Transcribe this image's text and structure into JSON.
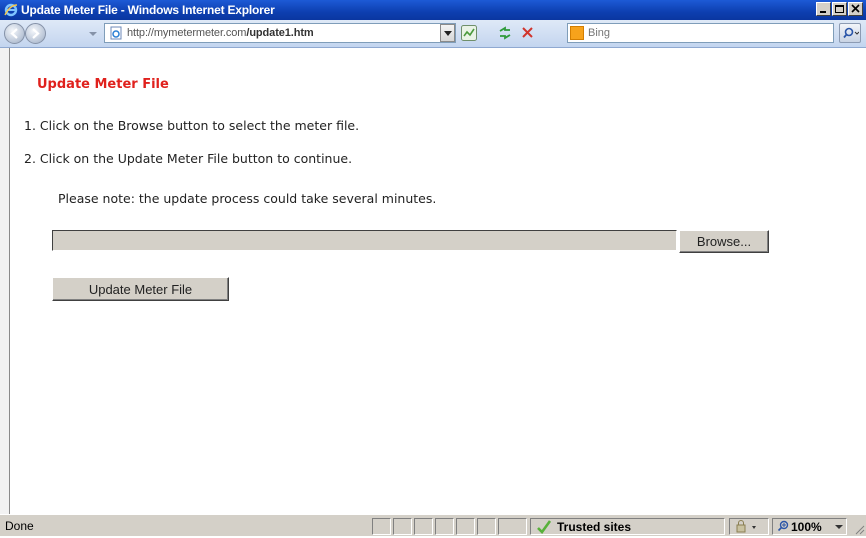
{
  "window": {
    "title": "Update Meter File - Windows Internet Explorer"
  },
  "navbar": {
    "url_host": "http://mymetermeter.com",
    "url_path": "/update1.htm",
    "search_placeholder": "Bing"
  },
  "page": {
    "title": "Update Meter File",
    "step1": "1. Click on the Browse button to select the meter file.",
    "step2": "2. Click on the Update Meter File button to continue.",
    "note": "Please note: the update process could take several minutes.",
    "file_value": "",
    "browse_label": "Browse...",
    "update_label": "Update Meter File"
  },
  "statusbar": {
    "status": "Done",
    "zone": "Trusted sites",
    "zoom": "100%"
  },
  "colors": {
    "title_red": "#e0211d",
    "titlebar_blue": "#0d3fb0",
    "chrome_gray": "#d4d0c8"
  },
  "icons": [
    "ie-logo-icon",
    "minimize-icon",
    "maximize-icon",
    "close-icon",
    "back-icon",
    "forward-icon",
    "page-icon",
    "compatibility-icon",
    "refresh-icon",
    "stop-icon",
    "bing-icon",
    "search-icon",
    "check-icon",
    "lock-icon",
    "zoom-icon",
    "resize-grip-icon"
  ]
}
